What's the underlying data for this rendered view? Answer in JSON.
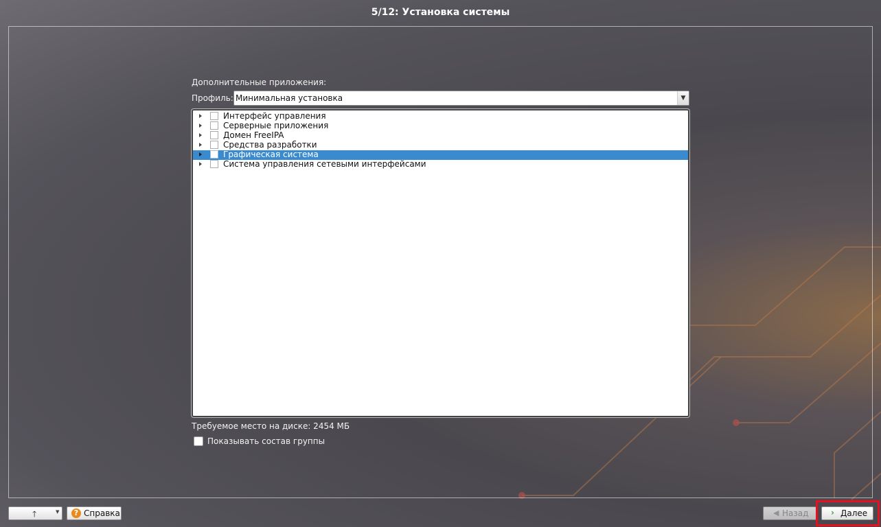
{
  "window": {
    "title": "5/12: Установка системы"
  },
  "section_label": "Дополнительные приложения:",
  "profile": {
    "label": "Профиль:",
    "value": "Минимальная установка"
  },
  "tree_items": [
    {
      "label": "Интерфейс управления",
      "checked": false,
      "selected": false
    },
    {
      "label": "Серверные приложения",
      "checked": false,
      "selected": false
    },
    {
      "label": "Домен FreeIPA",
      "checked": false,
      "selected": false
    },
    {
      "label": "Средства разработки",
      "checked": false,
      "selected": false
    },
    {
      "label": "Графическая система",
      "checked": false,
      "selected": true
    },
    {
      "label": "Система управления сетевыми интерфейсами",
      "checked": false,
      "selected": false
    }
  ],
  "disk_info": "Требуемое место на диске: 2454 МБ",
  "show_group": {
    "label": "Показывать состав группы",
    "checked": false
  },
  "buttons": {
    "up_icon": "up-arrow-icon",
    "help": "Справка",
    "back": "Назад",
    "next": "Далее"
  },
  "colors": {
    "selection": "#3a8ad0",
    "help_icon": "#e88a1c",
    "next_icon": "#3aa03a",
    "highlight": "#e8101e"
  }
}
